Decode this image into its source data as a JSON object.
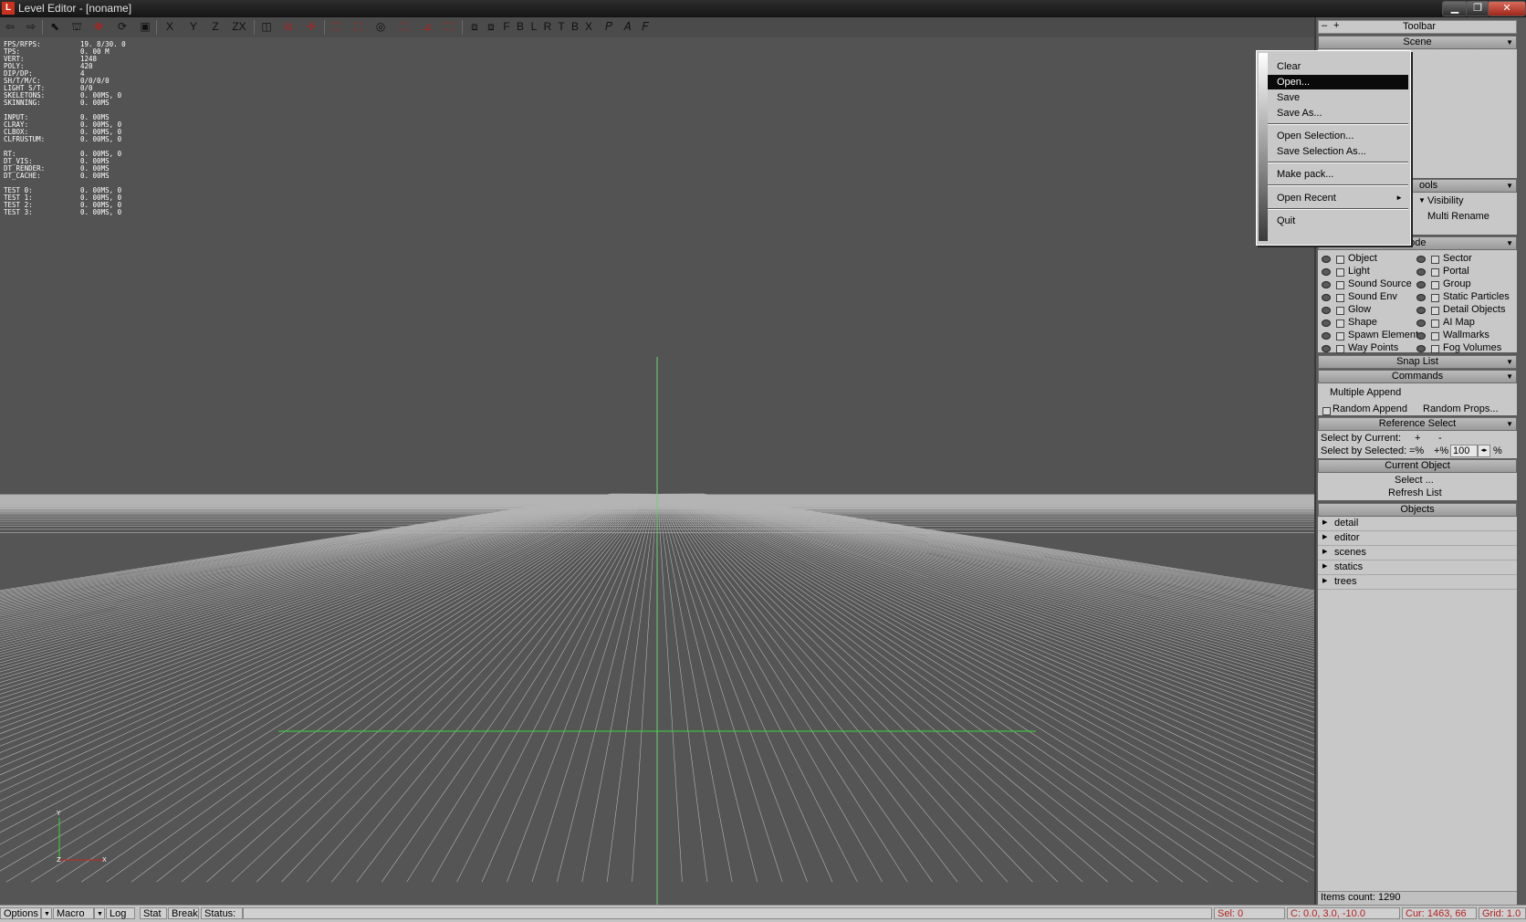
{
  "window": {
    "title": "Level Editor - [noname]",
    "icon": "L"
  },
  "toolbar": {
    "view_letters": [
      "F",
      "B",
      "L",
      "R",
      "T",
      "B",
      "X"
    ],
    "axis_buttons": [
      "X",
      "Y",
      "Z",
      "ZX"
    ]
  },
  "stats": [
    [
      "FPS/RFPS:",
      "19. 8/30. 0"
    ],
    [
      "TPS:",
      "0. 00 M"
    ],
    [
      "VERT:",
      "1248"
    ],
    [
      "POLY:",
      "420"
    ],
    [
      "DIP/DP:",
      "4"
    ],
    [
      "SH/T/M/C:",
      "0/0/0/0"
    ],
    [
      "LIGHT S/T:",
      "0/0"
    ],
    [
      "SKELETONS:",
      "0. 00MS, 0"
    ],
    [
      "SKINNING:",
      "0. 00MS"
    ],
    null,
    [
      "INPUT:",
      "0. 00MS"
    ],
    [
      "CLRAY:",
      "0. 00MS, 0"
    ],
    [
      "CLBOX:",
      "0. 00MS, 0"
    ],
    [
      "CLFRUSTUM:",
      "0. 00MS, 0"
    ],
    null,
    [
      " RT:",
      "0. 00MS, 0"
    ],
    [
      " DT_VIS:",
      "0. 00MS"
    ],
    [
      " DT_RENDER:",
      "0. 00MS"
    ],
    [
      " DT_CACHE:",
      "0. 00MS"
    ],
    null,
    [
      "TEST 0:",
      "0. 00MS, 0"
    ],
    [
      "TEST 1:",
      "0. 00MS, 0"
    ],
    [
      "TEST 2:",
      "0. 00MS, 0"
    ],
    [
      "TEST 3:",
      "0. 00MS, 0"
    ]
  ],
  "axis_gizmo": {
    "y": "Y",
    "z": "Z",
    "x": "X"
  },
  "file_menu": {
    "items": [
      "Clear",
      "Open...",
      "Save",
      "Save As...",
      "Open Selection...",
      "Save Selection As...",
      "Make pack...",
      "Open Recent",
      "Quit"
    ],
    "highlighted": "Open..."
  },
  "panel": {
    "toolbar_title": "Toolbar",
    "toolbar_minus": "–",
    "toolbar_plus": "+",
    "scene_title": "Scene",
    "tools_title": "ools",
    "tools_items": [
      "Visibility",
      "Multi Rename"
    ],
    "editmode_title": "Mode",
    "editmode_left": [
      "Object",
      "Light",
      "Sound Source",
      "Sound Env",
      "Glow",
      "Shape",
      "Spawn Element",
      "Way Points"
    ],
    "editmode_right": [
      "Sector",
      "Portal",
      "Group",
      "Static Particles",
      "Detail Objects",
      "AI Map",
      "Wallmarks",
      "Fog Volumes"
    ],
    "snaplist_title": "Snap List",
    "commands_title": "Commands",
    "multiple_append": "Multiple Append",
    "random_append": "Random Append",
    "random_props": "Random Props...",
    "refselect_title": "Reference Select",
    "select_by_current": "Select by Current:",
    "select_by_selected": "Select by Selected:",
    "plus": "+",
    "minus": "-",
    "eq_pct": "=%",
    "plus_pct": "+%",
    "pct_value": "100",
    "pct_sign": "%",
    "current_object_title": "Current Object",
    "select_btn": "Select ...",
    "refresh_btn": "Refresh List",
    "objects_title": "Objects",
    "objects": [
      "detail",
      "editor",
      "scenes",
      "statics",
      "trees"
    ],
    "items_count": "Items count: 1290"
  },
  "statusbar": {
    "options": "Options",
    "macro": "Macro",
    "log": "Log",
    "stat": "Stat",
    "break": "Break",
    "status": "Status:",
    "sel": "Sel: 0",
    "coords": "C: 0.0, 3.0, -10.0",
    "cursor": "Cur: 1463, 66",
    "grid": "Grid: 1.0"
  },
  "colors": {
    "viewport_bg": "#535353",
    "grid_line": "#b4b4b4",
    "axis_green": "#3cd23c",
    "panel_bg": "#c8c8c8",
    "menu_highlight": "#0a0a0a",
    "toolbar_red": "#b41e1e"
  }
}
